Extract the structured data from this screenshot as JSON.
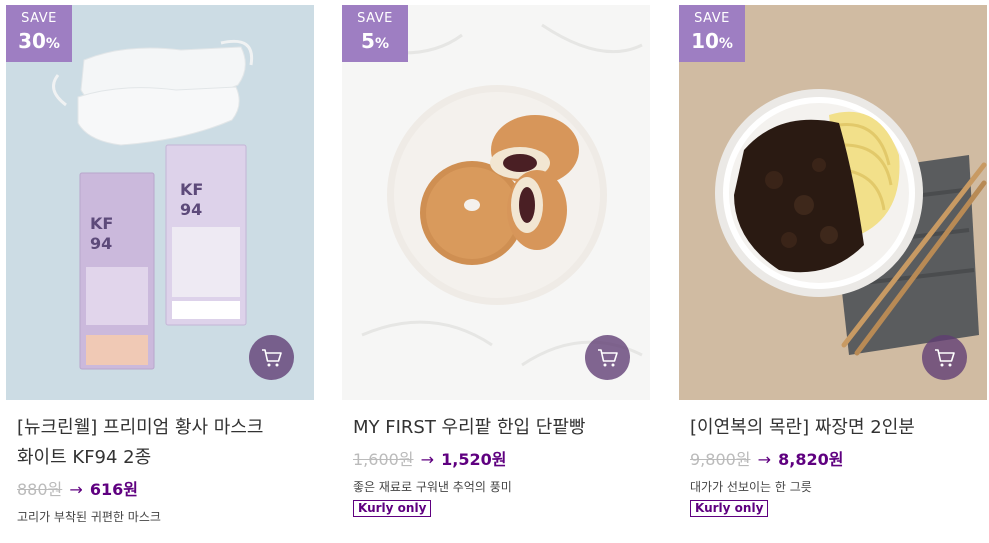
{
  "products": [
    {
      "save_word": "SAVE",
      "save_percent": "30",
      "percent_sign": "%",
      "name_line1": "[뉴크린웰] 프리미엄 황사 마스크",
      "name_line2": "화이트 KF94 2종",
      "original_price": "880원",
      "arrow": "→",
      "sale_price": "616원",
      "description": "고리가 부착된 귀편한 마스크",
      "image_icon": "mask-product-photo",
      "cart_icon": "cart-icon"
    },
    {
      "save_word": "SAVE",
      "save_percent": "5",
      "percent_sign": "%",
      "name_line1": "MY FIRST 우리팥 한입 단팥빵",
      "name_line2": "",
      "original_price": "1,600원",
      "arrow": "→",
      "sale_price": "1,520원",
      "description": "좋은 재료로 구워낸 추억의 풍미",
      "tag": "Kurly only",
      "image_icon": "bread-product-photo",
      "cart_icon": "cart-icon"
    },
    {
      "save_word": "SAVE",
      "save_percent": "10",
      "percent_sign": "%",
      "name_line1": "[이연복의 목란] 짜장면 2인분",
      "name_line2": "",
      "original_price": "9,800원",
      "arrow": "→",
      "sale_price": "8,820원",
      "description": "대가가 선보이는 한 그릇",
      "tag": "Kurly only",
      "image_icon": "jjajangmyeon-product-photo",
      "cart_icon": "cart-icon"
    }
  ],
  "colors": {
    "badge": "#9e7ec2",
    "brand_purple": "#5f0080",
    "strike_gray": "#bbbbbb"
  }
}
